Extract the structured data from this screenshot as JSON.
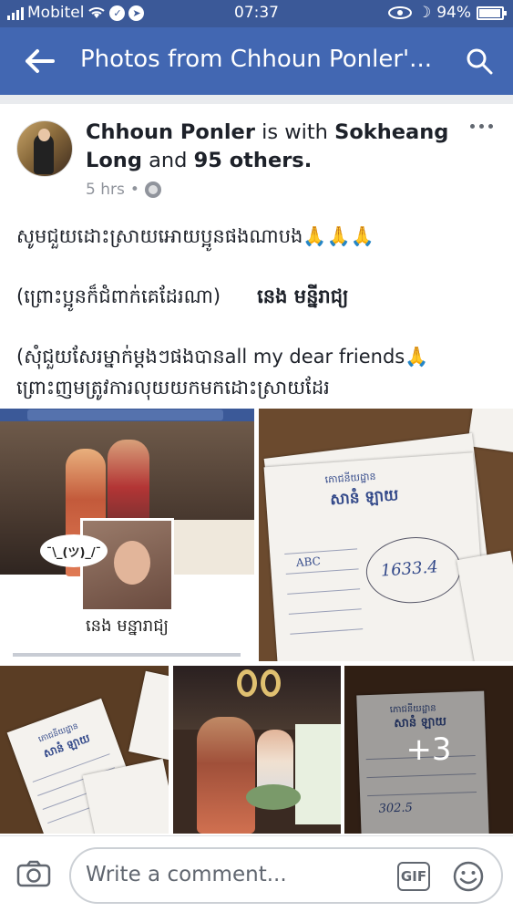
{
  "status_bar": {
    "carrier": "Mobitel",
    "time": "07:37",
    "battery": "94%",
    "battery_level": 0.94
  },
  "nav": {
    "title": "Photos from Chhoun Ponler'..."
  },
  "post": {
    "author": "Chhoun Ponler",
    "is_with": "is with",
    "tagged_name": "Sokheang Long",
    "and": "and",
    "others": "95 others.",
    "time": "5 hrs",
    "time_separator": "•",
    "line1": "សូមជួយដោះស្រាយអោយប្អូនផងណាបង🙏🙏🙏",
    "line2": "(ព្រោះប្អូនក៏ជំពាក់គេដែរណា)",
    "line2_name": "នេង មន្នីរាជ្យ",
    "line3": "(សុំជួយសែរម្នាក់ម្ដងៗផងបានall my dear friends🙏",
    "line4": "ព្រោះញមត្រូវការលុយយកមកដោះស្រាយដែរ"
  },
  "photos": {
    "p1_name": "នេង មន្នារាជ្យ",
    "p1_bubble": "¯\\_(ツ)_/¯",
    "receipt_store": "ភោជនីយដ្ឋាន",
    "receipt_brand": "សានំ ឡាយ",
    "receipt_total": "1633.4",
    "receipt_small_total": "302.5",
    "receipt_row": "ABC",
    "more_count": "+3"
  },
  "comment": {
    "placeholder": "Write a comment...",
    "gif_label": "GIF"
  },
  "colors": {
    "statusbar": "#3b5998",
    "navbar": "#4267b2",
    "text": "#1d2129",
    "muted": "#90949c"
  }
}
